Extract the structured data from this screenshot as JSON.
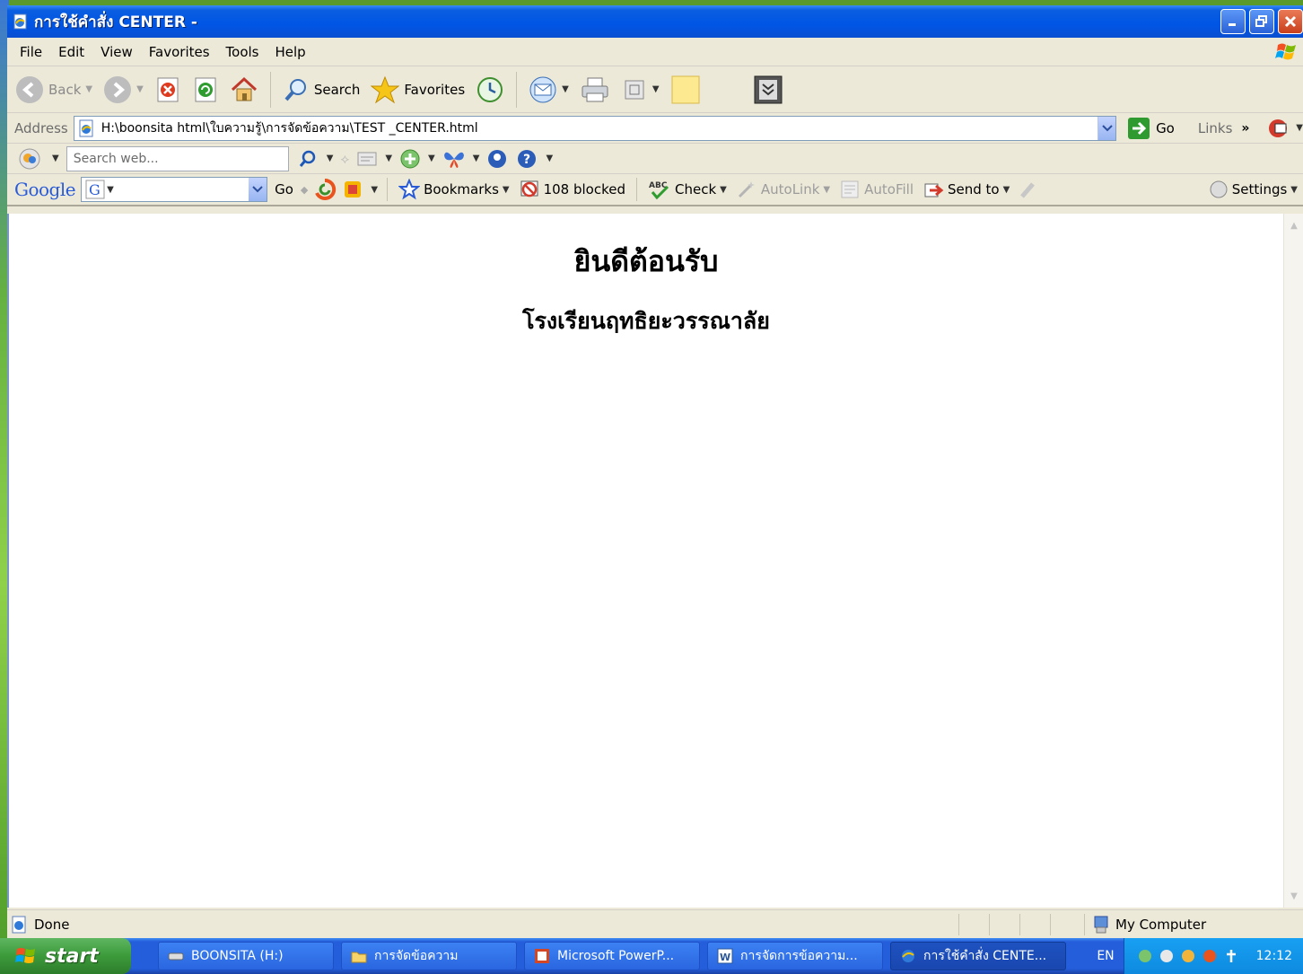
{
  "window": {
    "title": "การใช้คำสั่ง CENTER -"
  },
  "menu": [
    "File",
    "Edit",
    "View",
    "Favorites",
    "Tools",
    "Help"
  ],
  "toolbar": {
    "back_label": "Back",
    "search_label": "Search",
    "favorites_label": "Favorites"
  },
  "address": {
    "label": "Address",
    "url": "H:\\boonsita html\\ใบความรู้\\การจัดข้อความ\\TEST _CENTER.html",
    "go_label": "Go",
    "links_label": "Links"
  },
  "search_toolbar": {
    "placeholder": "Search web..."
  },
  "google_toolbar": {
    "logo": "Google",
    "go_label": "Go",
    "bookmarks_label": "Bookmarks",
    "blocked_label": "108 blocked",
    "check_label": "Check",
    "autolink_label": "AutoLink",
    "autofill_label": "AutoFill",
    "sendto_label": "Send to",
    "settings_label": "Settings"
  },
  "page": {
    "heading": "ยินดีต้อนรับ",
    "subheading": "โรงเรียนฤทธิยะวรรณาลัย"
  },
  "status": {
    "text": "Done",
    "zone": "My Computer"
  },
  "taskbar": {
    "start_label": "start",
    "tasks": [
      "BOONSITA (H:)",
      "การจัดข้อความ",
      "Microsoft PowerP...",
      "การจัดการข้อความ...",
      "การใช้คำสั่ง CENTE..."
    ],
    "language": "EN",
    "clock": "12:12"
  }
}
